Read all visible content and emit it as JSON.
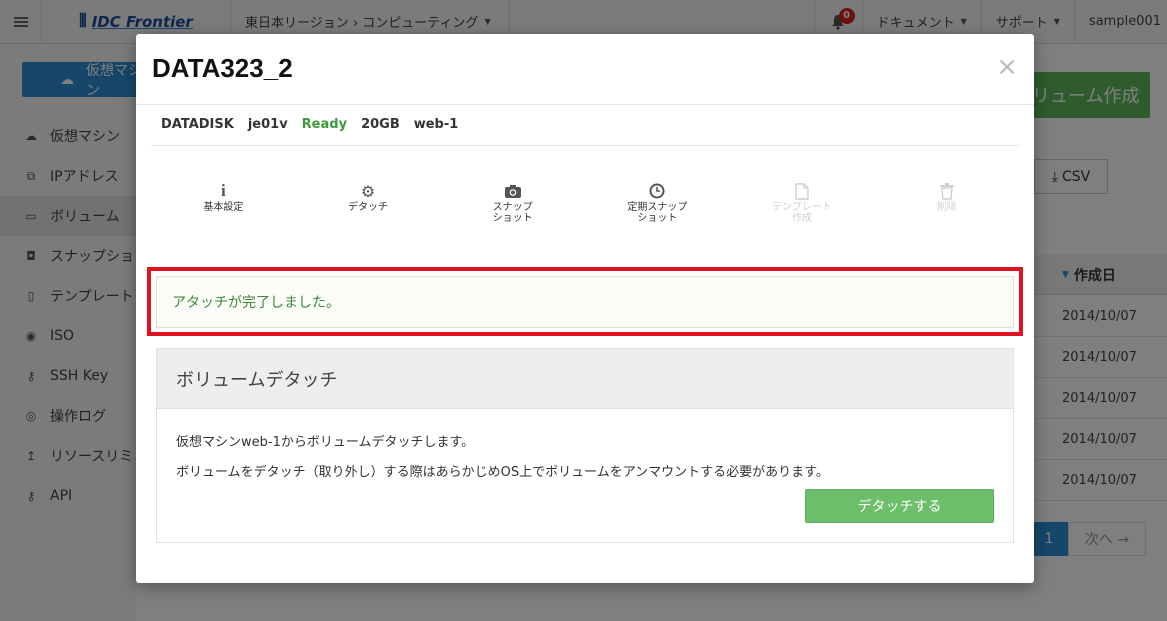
{
  "topbar": {
    "logo_text": "IDC Frontier",
    "region_label": "東日本リージョン ›  コンピューティング",
    "notification_count": "0",
    "docs_label": "ドキュメント",
    "support_label": "サポート",
    "user_label": "sample001"
  },
  "sidebar": {
    "create_vm_label": "仮想マシン",
    "items": [
      {
        "label": "仮想マシン",
        "icon": "cloud-icon"
      },
      {
        "label": "IPアドレス",
        "icon": "sitemap-icon"
      },
      {
        "label": "ボリューム",
        "icon": "hdd-icon"
      },
      {
        "label": "スナップショ",
        "icon": "camera-icon"
      },
      {
        "label": "テンプレート",
        "icon": "file-icon"
      },
      {
        "label": "ISO",
        "icon": "disc-icon"
      },
      {
        "label": "SSH Key",
        "icon": "key-icon"
      },
      {
        "label": "操作ログ",
        "icon": "eye-icon"
      },
      {
        "label": "リソースリミ",
        "icon": "upload-icon"
      },
      {
        "label": "API",
        "icon": "key-icon"
      }
    ]
  },
  "background": {
    "create_volume_label": "リューム作成",
    "csv_label": "CSV",
    "date_header": "作成日",
    "dates": [
      "2014/10/07",
      "2014/10/07",
      "2014/10/07",
      "2014/10/07",
      "2014/10/07"
    ],
    "page_current": "1",
    "page_next": "次へ →"
  },
  "modal": {
    "title": "DATA323_2",
    "close_symbol": "×",
    "props": {
      "type": "DATADISK",
      "zone": "je01v",
      "status": "Ready",
      "size": "20GB",
      "vm": "web-1"
    },
    "actions": [
      {
        "label": "基本設定",
        "icon": "info-icon",
        "disabled": false
      },
      {
        "label": "デタッチ",
        "icon": "gear-icon",
        "disabled": false
      },
      {
        "label": "スナップ\nショット",
        "icon": "camera-icon",
        "disabled": false
      },
      {
        "label": "定期スナップ\nショット",
        "icon": "clock-icon",
        "disabled": false
      },
      {
        "label": "テンプレート\n作成",
        "icon": "file-icon",
        "disabled": true
      },
      {
        "label": "削除",
        "icon": "trash-icon",
        "disabled": true
      }
    ],
    "success_message": "アタッチが完了しました。",
    "panel": {
      "heading": "ボリュームデタッチ",
      "text1": "仮想マシンweb-1からボリュームデタッチします。",
      "text2": "ボリュームをデタッチ（取り外し）する際はあらかじめOS上でボリュームをアンマウントする必要があります。",
      "button_label": "デタッチする"
    }
  },
  "colors": {
    "accent_blue": "#2c8fd4",
    "success_green": "#6cbe6a",
    "highlight_red": "#e1121f",
    "ready_green": "#3c9a3c"
  }
}
